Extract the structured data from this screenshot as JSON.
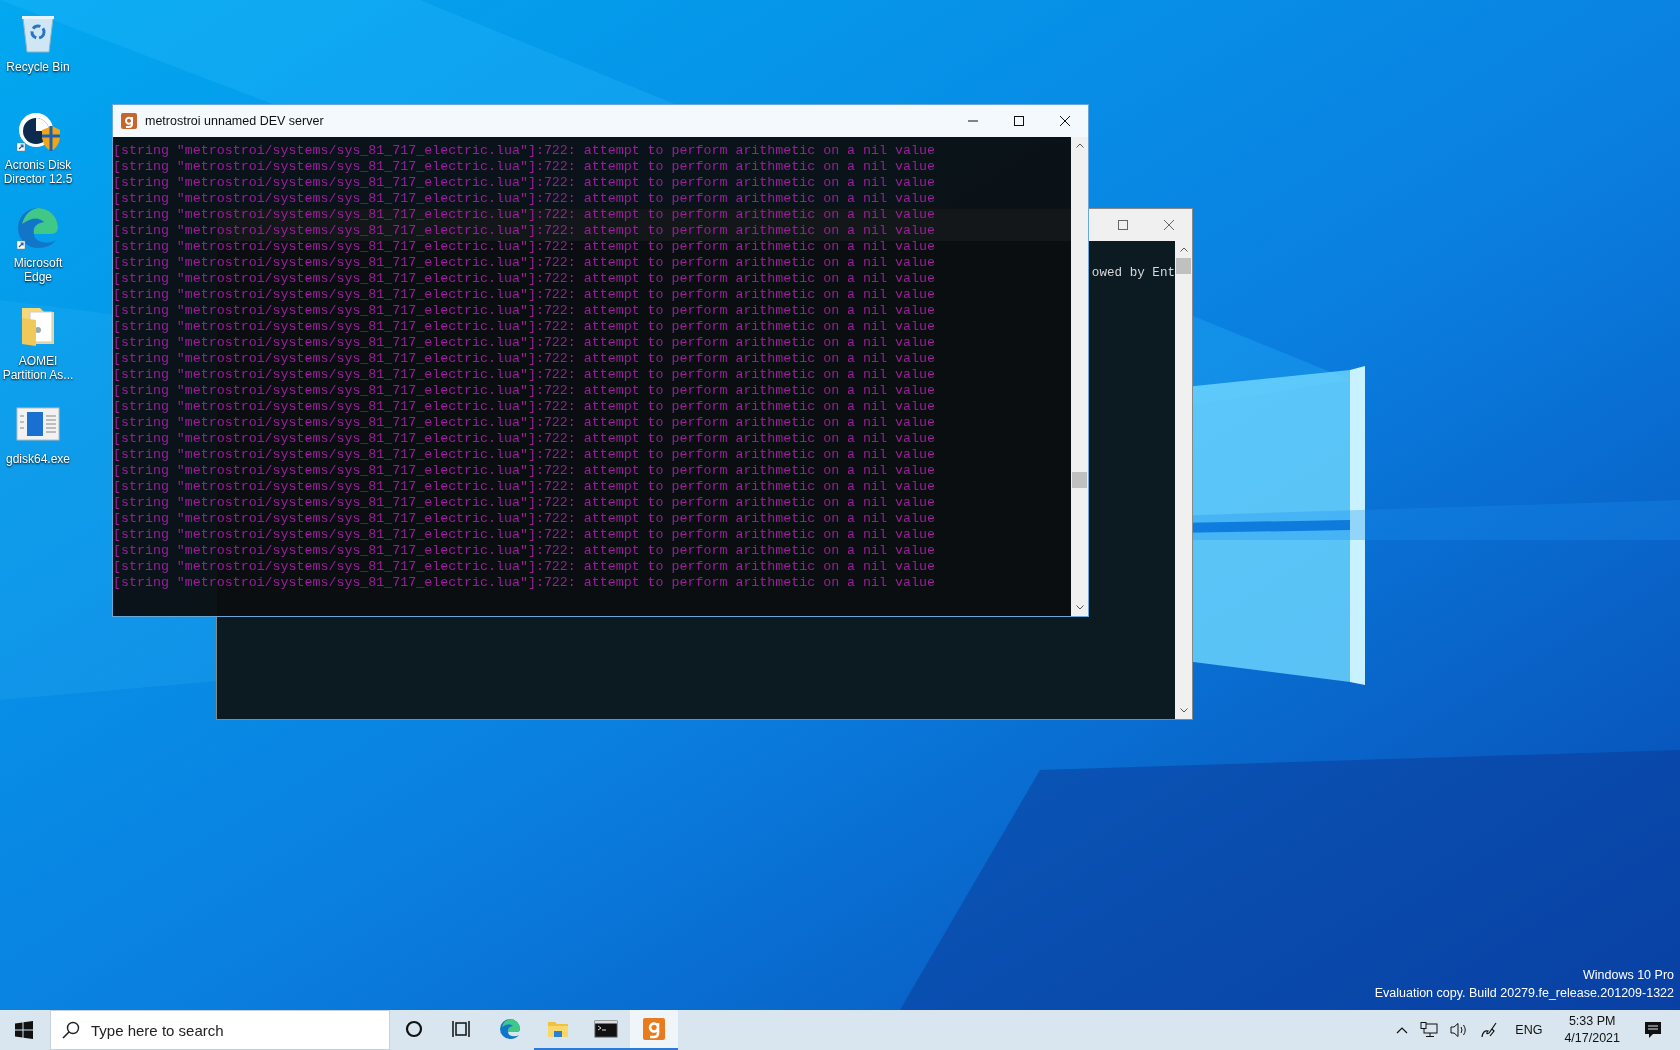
{
  "desktop_icons": [
    {
      "label": "Recycle Bin",
      "kind": "recycle",
      "shortcut": false
    },
    {
      "label": "Acronis Disk Director 12.5",
      "kind": "acronis",
      "shortcut": true
    },
    {
      "label": "Microsoft Edge",
      "kind": "edge",
      "shortcut": true
    },
    {
      "label": "AOMEI Partition As...",
      "kind": "folder",
      "shortcut": false
    },
    {
      "label": "gdisk64.exe",
      "kind": "exe",
      "shortcut": false
    }
  ],
  "back_window": {
    "lines": [
      "owed by Ent"
    ]
  },
  "front_window": {
    "title": "metrostroi unnamed DEV server",
    "lines": [
      "[string \"metrostroi/systems/sys_81_717_electric.lua\"]:722: attempt to perform arithmetic on a nil value",
      "[string \"metrostroi/systems/sys_81_717_electric.lua\"]:722: attempt to perform arithmetic on a nil value",
      "[string \"metrostroi/systems/sys_81_717_electric.lua\"]:722: attempt to perform arithmetic on a nil value",
      "[string \"metrostroi/systems/sys_81_717_electric.lua\"]:722: attempt to perform arithmetic on a nil value",
      "[string \"metrostroi/systems/sys_81_717_electric.lua\"]:722: attempt to perform arithmetic on a nil value",
      "[string \"metrostroi/systems/sys_81_717_electric.lua\"]:722: attempt to perform arithmetic on a nil value",
      "[string \"metrostroi/systems/sys_81_717_electric.lua\"]:722: attempt to perform arithmetic on a nil value",
      "[string \"metrostroi/systems/sys_81_717_electric.lua\"]:722: attempt to perform arithmetic on a nil value",
      "[string \"metrostroi/systems/sys_81_717_electric.lua\"]:722: attempt to perform arithmetic on a nil value",
      "[string \"metrostroi/systems/sys_81_717_electric.lua\"]:722: attempt to perform arithmetic on a nil value",
      "[string \"metrostroi/systems/sys_81_717_electric.lua\"]:722: attempt to perform arithmetic on a nil value",
      "[string \"metrostroi/systems/sys_81_717_electric.lua\"]:722: attempt to perform arithmetic on a nil value",
      "[string \"metrostroi/systems/sys_81_717_electric.lua\"]:722: attempt to perform arithmetic on a nil value",
      "[string \"metrostroi/systems/sys_81_717_electric.lua\"]:722: attempt to perform arithmetic on a nil value",
      "[string \"metrostroi/systems/sys_81_717_electric.lua\"]:722: attempt to perform arithmetic on a nil value",
      "[string \"metrostroi/systems/sys_81_717_electric.lua\"]:722: attempt to perform arithmetic on a nil value",
      "[string \"metrostroi/systems/sys_81_717_electric.lua\"]:722: attempt to perform arithmetic on a nil value",
      "[string \"metrostroi/systems/sys_81_717_electric.lua\"]:722: attempt to perform arithmetic on a nil value",
      "[string \"metrostroi/systems/sys_81_717_electric.lua\"]:722: attempt to perform arithmetic on a nil value",
      "[string \"metrostroi/systems/sys_81_717_electric.lua\"]:722: attempt to perform arithmetic on a nil value",
      "[string \"metrostroi/systems/sys_81_717_electric.lua\"]:722: attempt to perform arithmetic on a nil value",
      "[string \"metrostroi/systems/sys_81_717_electric.lua\"]:722: attempt to perform arithmetic on a nil value",
      "[string \"metrostroi/systems/sys_81_717_electric.lua\"]:722: attempt to perform arithmetic on a nil value",
      "[string \"metrostroi/systems/sys_81_717_electric.lua\"]:722: attempt to perform arithmetic on a nil value",
      "[string \"metrostroi/systems/sys_81_717_electric.lua\"]:722: attempt to perform arithmetic on a nil value",
      "[string \"metrostroi/systems/sys_81_717_electric.lua\"]:722: attempt to perform arithmetic on a nil value",
      "[string \"metrostroi/systems/sys_81_717_electric.lua\"]:722: attempt to perform arithmetic on a nil value",
      "[string \"metrostroi/systems/sys_81_717_electric.lua\"]:722: attempt to perform arithmetic on a nil value"
    ]
  },
  "desktop_notice": {
    "edition": "Windows 10 Pro",
    "build": "Evaluation copy. Build 20279.fe_release.201209-1322"
  },
  "taskbar": {
    "search": {
      "placeholder": "Type here to search"
    },
    "apps": [
      {
        "kind": "cortana",
        "running": false,
        "selected": false
      },
      {
        "kind": "taskview",
        "running": false,
        "selected": false
      },
      {
        "kind": "edge",
        "running": false,
        "selected": false
      },
      {
        "kind": "explorer",
        "running": true,
        "selected": false
      },
      {
        "kind": "terminal",
        "running": true,
        "selected": false
      },
      {
        "kind": "gmod",
        "running": true,
        "selected": true
      }
    ],
    "tray": {
      "language": "ENG",
      "time": "5:33 PM",
      "date": "4/17/2021"
    }
  }
}
